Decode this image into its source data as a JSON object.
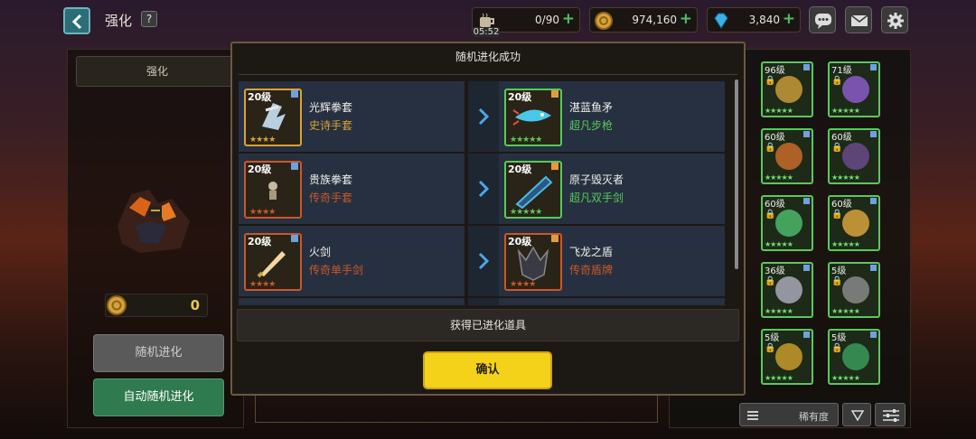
{
  "header": {
    "title": "强化",
    "help_label": "?",
    "stamina": "0/90",
    "timer": "05:52",
    "gold": "974,160",
    "gems": "3,840",
    "plus": "+"
  },
  "left": {
    "tab_label": "强化",
    "gold_cost": "0",
    "random_evolve_label": "随机进化",
    "auto_random_evolve_label": "自动随机进化"
  },
  "modal": {
    "title": "随机进化成功",
    "obtain_label": "获得已进化道具",
    "confirm_label": "确认",
    "rows": [
      {
        "from": {
          "level": "20级",
          "name": "光辉拳套",
          "type": "史诗手套",
          "stars": "★★★★",
          "rarity": "epic"
        },
        "to": {
          "level": "20级",
          "name": "湛蓝鱼矛",
          "type": "超凡步枪",
          "stars": "★★★★★",
          "rarity": "transcendent"
        }
      },
      {
        "from": {
          "level": "20级",
          "name": "贵族拳套",
          "type": "传奇手套",
          "stars": "★★★★",
          "rarity": "legendary"
        },
        "to": {
          "level": "20级",
          "name": "原子毁灭者",
          "type": "超凡双手剑",
          "stars": "★★★★★",
          "rarity": "transcendent"
        }
      },
      {
        "from": {
          "level": "20级",
          "name": "火剑",
          "type": "传奇单手剑",
          "stars": "★★★★",
          "rarity": "legendary"
        },
        "to": {
          "level": "20级",
          "name": "飞龙之盾",
          "type": "传奇盾牌",
          "stars": "★★★★",
          "rarity": "legendary"
        }
      }
    ]
  },
  "inventory": {
    "items": [
      {
        "level": "96级",
        "stars": "★★★★★"
      },
      {
        "level": "71级",
        "stars": "★★★★★"
      },
      {
        "level": "60级",
        "stars": "★★★★★"
      },
      {
        "level": "60级",
        "stars": "★★★★★"
      },
      {
        "level": "60级",
        "stars": "★★★★★"
      },
      {
        "level": "60级",
        "stars": "★★★★★"
      },
      {
        "level": "36级",
        "stars": "★★★★★"
      },
      {
        "level": "5级",
        "stars": "★★★★★"
      },
      {
        "level": "5级",
        "stars": "★★★★★"
      },
      {
        "level": "5级",
        "stars": "★★★★★"
      }
    ],
    "rarity_label": "稀有度"
  },
  "colors": {
    "epic": "#d8a23a",
    "legendary": "#c8582a",
    "transcendent": "#5ac85a",
    "accent_yellow": "#f5d21a",
    "green": "#4fbf6a"
  }
}
